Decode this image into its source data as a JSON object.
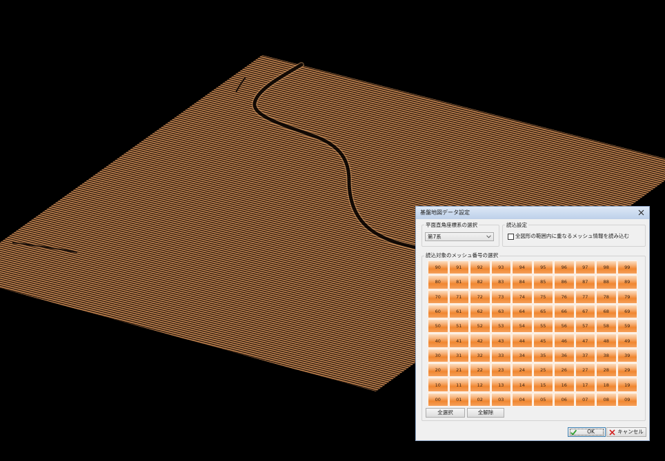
{
  "dialog": {
    "title": "基盤地図データ設定",
    "close_icon": "close-icon"
  },
  "coordinate_system": {
    "group_label": "平面直角座標系の選択",
    "selected": "第7系",
    "dropdown_icon": "chevron-down-icon"
  },
  "load_settings": {
    "group_label": "読込設定",
    "checkbox_label": "全図形の範囲内に重なるメッシュ情報を読み込む",
    "checked": false
  },
  "mesh": {
    "group_label": "読込対象のメッシュ番号の選択",
    "rows": [
      [
        "90",
        "91",
        "92",
        "93",
        "94",
        "95",
        "96",
        "97",
        "98",
        "99"
      ],
      [
        "80",
        "81",
        "82",
        "83",
        "84",
        "85",
        "86",
        "87",
        "88",
        "89"
      ],
      [
        "70",
        "71",
        "72",
        "73",
        "74",
        "75",
        "76",
        "77",
        "78",
        "79"
      ],
      [
        "60",
        "61",
        "62",
        "63",
        "64",
        "65",
        "66",
        "67",
        "68",
        "69"
      ],
      [
        "50",
        "51",
        "52",
        "53",
        "54",
        "55",
        "56",
        "57",
        "58",
        "59"
      ],
      [
        "40",
        "41",
        "42",
        "43",
        "44",
        "45",
        "46",
        "47",
        "48",
        "49"
      ],
      [
        "30",
        "31",
        "32",
        "33",
        "34",
        "35",
        "36",
        "37",
        "38",
        "39"
      ],
      [
        "20",
        "21",
        "22",
        "23",
        "24",
        "25",
        "26",
        "27",
        "28",
        "29"
      ],
      [
        "10",
        "11",
        "12",
        "13",
        "14",
        "15",
        "16",
        "17",
        "18",
        "19"
      ],
      [
        "00",
        "01",
        "02",
        "03",
        "04",
        "05",
        "06",
        "07",
        "08",
        "09"
      ]
    ],
    "select_all_label": "全選択",
    "clear_all_label": "全解除"
  },
  "footer": {
    "ok_label": "OK",
    "ok_icon": "check-icon",
    "cancel_label": "キャンセル",
    "cancel_icon": "x-icon"
  },
  "colors": {
    "background": "#000000",
    "terrain_line": "#c98852",
    "terrain_gap": "#2a190d",
    "river": "#120a05",
    "mesh_cell": "#f08731"
  }
}
